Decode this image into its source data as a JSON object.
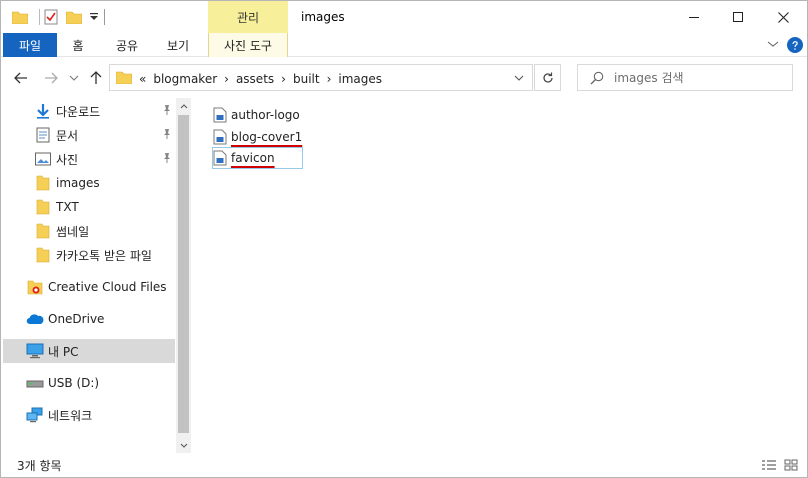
{
  "window": {
    "title": "images"
  },
  "quick_access": {
    "icons": [
      "folder-icon",
      "properties-icon",
      "new-folder-icon",
      "customize-dropdown-icon"
    ]
  },
  "contextual_tab": {
    "header": "관리",
    "label": "사진 도구"
  },
  "ribbon": {
    "tabs": [
      "파일",
      "홈",
      "공유",
      "보기"
    ]
  },
  "address": {
    "overflow": "«",
    "crumbs": [
      "blogmaker",
      "assets",
      "built",
      "images"
    ]
  },
  "search": {
    "placeholder": "images 검색"
  },
  "nav_pane": {
    "items": [
      {
        "label": "다운로드",
        "icon": "download-icon",
        "pinned": true
      },
      {
        "label": "문서",
        "icon": "documents-icon",
        "pinned": true
      },
      {
        "label": "사진",
        "icon": "pictures-icon",
        "pinned": true
      },
      {
        "label": "images",
        "icon": "folder-icon",
        "pinned": false
      },
      {
        "label": "TXT",
        "icon": "folder-icon",
        "pinned": false
      },
      {
        "label": "썸네일",
        "icon": "folder-icon",
        "pinned": false
      },
      {
        "label": "카카오톡 받은 파일",
        "icon": "folder-icon",
        "pinned": false
      },
      {
        "label": "Creative Cloud Files",
        "icon": "creative-cloud-icon",
        "pinned": false
      },
      {
        "label": "OneDrive",
        "icon": "onedrive-icon",
        "pinned": false
      },
      {
        "label": "내 PC",
        "icon": "pc-icon",
        "pinned": false,
        "selected": true
      },
      {
        "label": "USB (D:)",
        "icon": "usb-drive-icon",
        "pinned": false
      },
      {
        "label": "네트워크",
        "icon": "network-icon",
        "pinned": false
      }
    ]
  },
  "files": [
    {
      "name": "author-logo",
      "icon": "image-file-icon"
    },
    {
      "name": "blog-cover1",
      "icon": "image-file-icon",
      "spellcheck_underline": true
    },
    {
      "name": "favicon",
      "icon": "image-file-icon",
      "spellcheck_underline": true,
      "focused": true
    }
  ],
  "status": {
    "item_count": "3개 항목"
  },
  "colors": {
    "file_tab_bg": "#1565c0",
    "contextual_tab_bg": "#f8ef9b",
    "selected_nav_bg": "#d9d9d9",
    "folder_yellow": "#f6cf57",
    "squiggle_red": "#d00000"
  }
}
